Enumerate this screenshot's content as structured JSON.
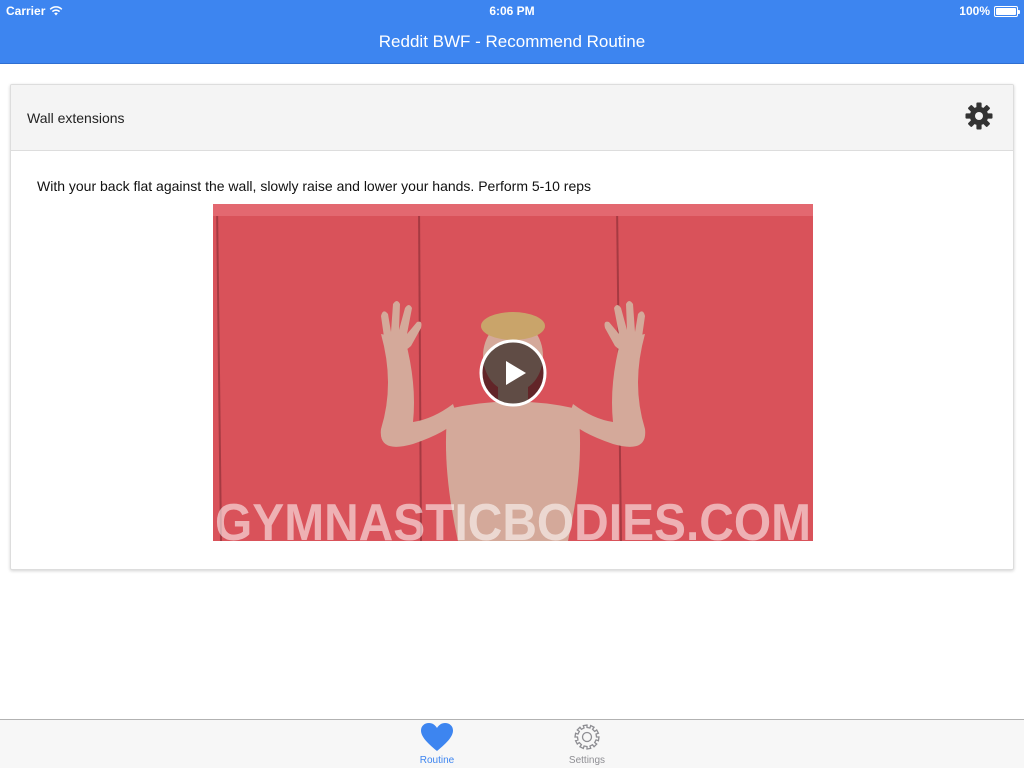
{
  "status_bar": {
    "carrier": "Carrier",
    "time": "6:06 PM",
    "battery": "100%",
    "battery_level": 1.0
  },
  "nav": {
    "title": "Reddit BWF - Recommend Routine"
  },
  "exercise": {
    "title": "Wall extensions",
    "gear_icon": "gear-icon",
    "description": "With your back flat against the wall, slowly raise and lower your hands. Perform 5-10 reps",
    "video": {
      "play_icon": "play-icon",
      "watermark": "GYMNASTICBODIES.COM"
    }
  },
  "tabs": [
    {
      "label": "Routine",
      "icon": "heart-icon",
      "selected": true
    },
    {
      "label": "Settings",
      "icon": "gear-icon",
      "selected": false
    }
  ],
  "colors": {
    "accent": "#3d85f0",
    "tab_inactive": "#8e8e93",
    "video_wall": "#d9525a"
  }
}
